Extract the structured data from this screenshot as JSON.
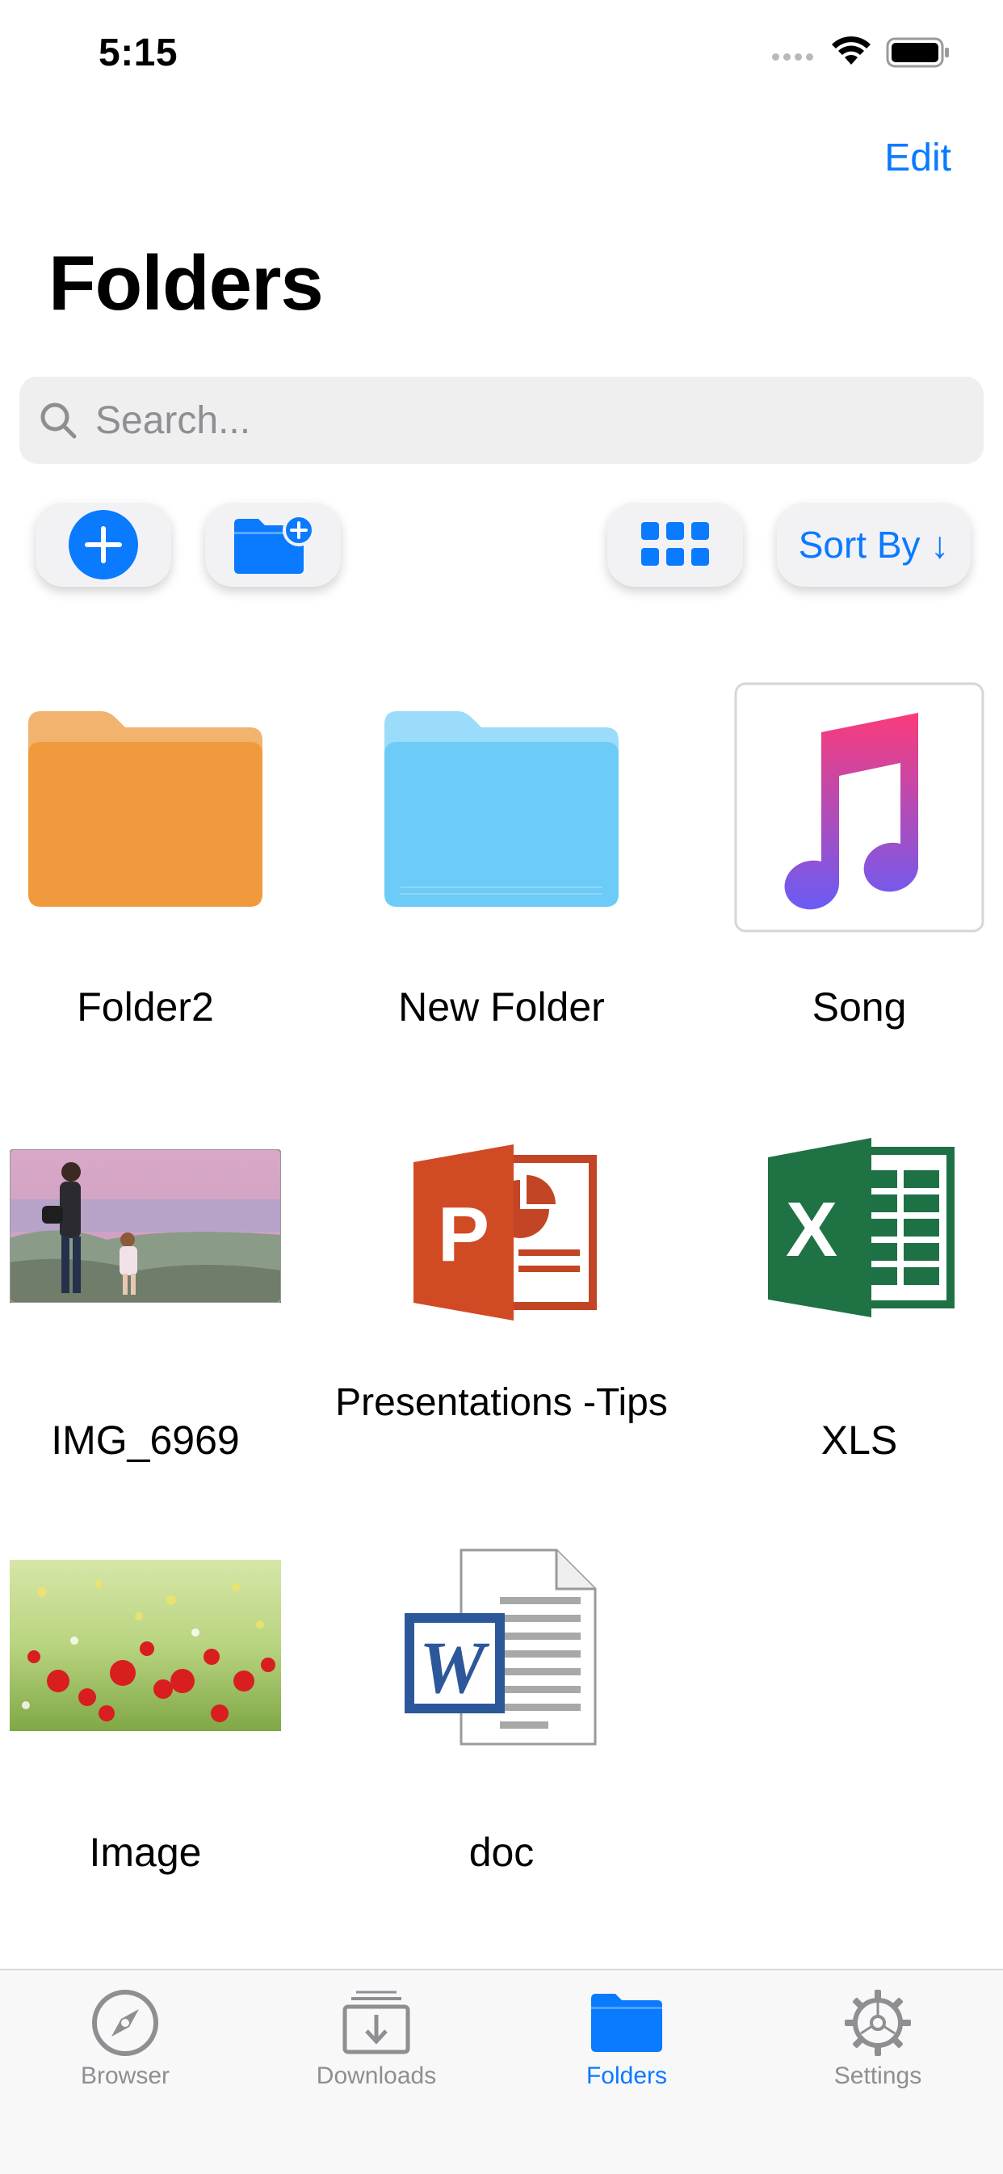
{
  "status_bar": {
    "time": "5:15"
  },
  "nav": {
    "edit_label": "Edit",
    "title": "Folders"
  },
  "search": {
    "placeholder": "Search..."
  },
  "toolbar": {
    "sort_label": "Sort By ↓"
  },
  "files": [
    {
      "name": "Folder2",
      "icon": "orange-folder-icon"
    },
    {
      "name": "New Folder",
      "icon": "blue-folder-icon"
    },
    {
      "name": "Song",
      "icon": "music-note-icon"
    },
    {
      "name": "IMG_6969",
      "icon": "photo-thumbnail"
    },
    {
      "name": "Presentations -Tips",
      "icon": "powerpoint-icon"
    },
    {
      "name": "XLS",
      "icon": "excel-icon"
    },
    {
      "name": "Image",
      "icon": "flowers-thumbnail"
    },
    {
      "name": "doc",
      "icon": "word-icon"
    }
  ],
  "tabs": [
    {
      "label": "Browser",
      "icon": "compass-icon",
      "active": false
    },
    {
      "label": "Downloads",
      "icon": "download-tray-icon",
      "active": false
    },
    {
      "label": "Folders",
      "icon": "folder-icon",
      "active": true
    },
    {
      "label": "Settings",
      "icon": "gear-icon",
      "active": false
    }
  ],
  "colors": {
    "accent": "#0a7aff",
    "folder_orange": "#f09a3d",
    "folder_blue": "#6ccbf7"
  }
}
